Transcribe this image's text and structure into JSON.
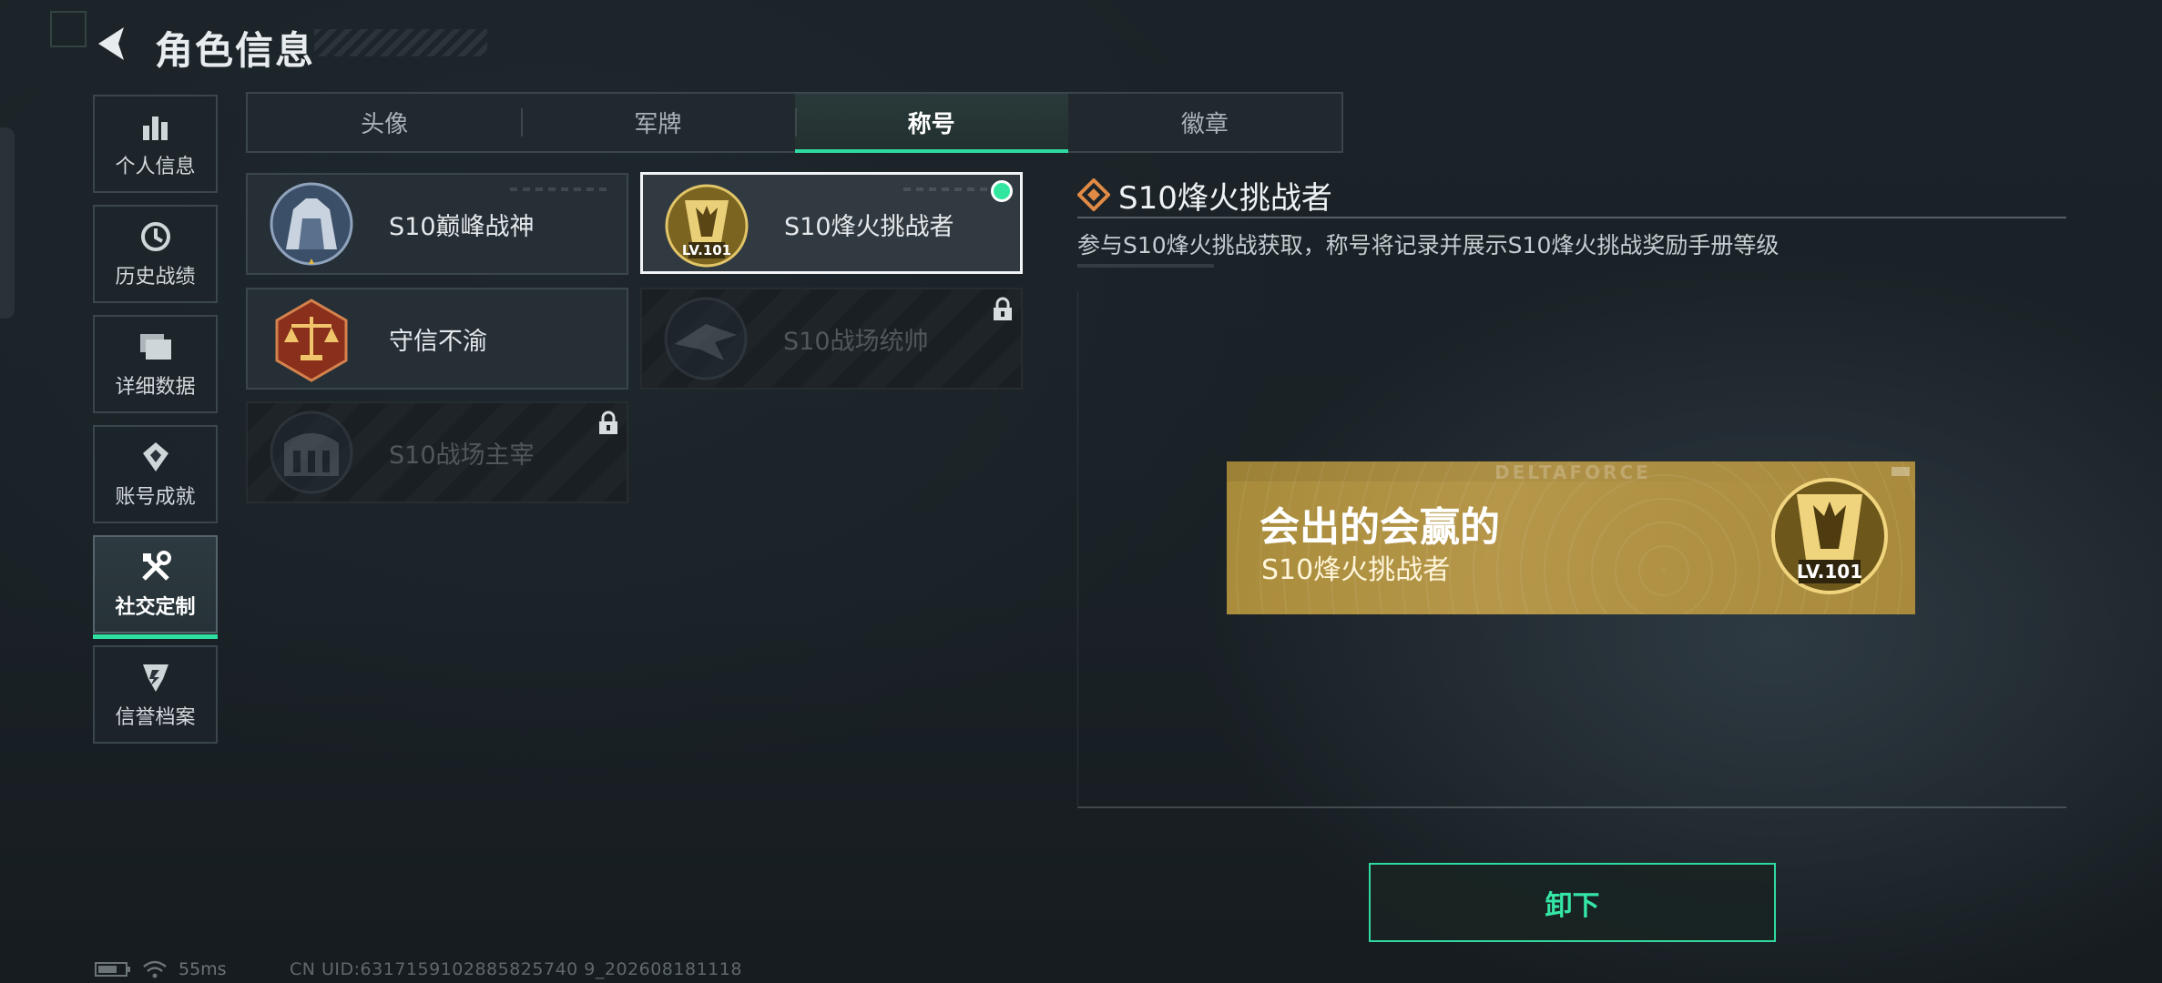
{
  "header": {
    "title": "角色信息",
    "back_icon": "back-arrow-icon"
  },
  "sidebar": {
    "items": [
      {
        "label": "个人信息",
        "icon": "bar-chart-icon"
      },
      {
        "label": "历史战绩",
        "icon": "history-icon"
      },
      {
        "label": "详细数据",
        "icon": "folder-icon"
      },
      {
        "label": "账号成就",
        "icon": "achievement-icon"
      },
      {
        "label": "社交定制",
        "icon": "tools-icon",
        "active": true
      },
      {
        "label": "信誉档案",
        "icon": "shield-icon"
      }
    ]
  },
  "tabs": [
    {
      "label": "头像"
    },
    {
      "label": "军牌"
    },
    {
      "label": "称号",
      "active": true
    },
    {
      "label": "徽章"
    }
  ],
  "titles": [
    {
      "name": "S10巅峰战神",
      "locked": false
    },
    {
      "name": "S10烽火挑战者",
      "locked": false,
      "selected": true,
      "equipped": true
    },
    {
      "name": "守信不渝",
      "locked": false
    },
    {
      "name": "S10战场统帅",
      "locked": true
    },
    {
      "name": "S10战场主宰",
      "locked": true
    }
  ],
  "detail": {
    "title": "S10烽火挑战者",
    "description": "参与S10烽火挑战获取，称号将记录并展示S10烽火挑战奖励手册等级"
  },
  "nameplate": {
    "brand": "DELTAFORCE",
    "player_name": "会出的会赢的",
    "title": "S10烽火挑战者",
    "badge_level": "LV.101"
  },
  "badge_level_label": "101",
  "badge_level_prefix": "LV.",
  "actions": {
    "unequip_label": "卸下"
  },
  "status": {
    "ping": "55ms",
    "uid": "CN UID:6317159102885825740 9_202608181118"
  },
  "colors": {
    "accent": "#2fd9a0",
    "gold": "#b6974a",
    "equipped": "#33e6a0"
  }
}
